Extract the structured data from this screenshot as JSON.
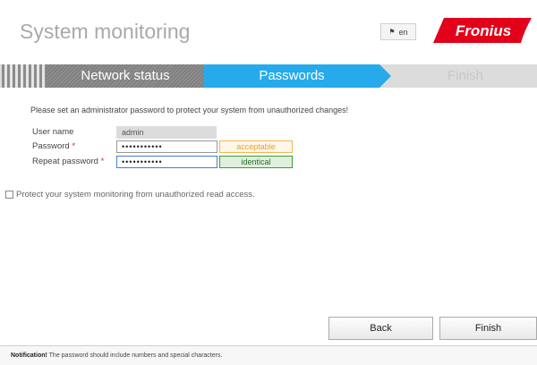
{
  "header": {
    "title": "System monitoring",
    "lang_label": "en",
    "lang_icon": "flag-icon",
    "brand": "Fronius",
    "brand_color": "#e3001b"
  },
  "steps": [
    {
      "label": "Network status",
      "state": "done"
    },
    {
      "label": "Passwords",
      "state": "active"
    },
    {
      "label": "Finish",
      "state": "pending"
    }
  ],
  "accent_color": "#26aaec",
  "intro": "Please set an administrator password to protect your system from unauthorized changes!",
  "form": {
    "username_label": "User name",
    "username_value": "admin",
    "password_label": "Password",
    "password_value": "•••••••••••",
    "repeat_label": "Repeat password",
    "repeat_value": "•••••••••••",
    "required_mark": "*",
    "password_status": "acceptable",
    "repeat_status": "identical"
  },
  "protect_label": "Protect your system monitoring from unauthorized read access.",
  "buttons": {
    "back": "Back",
    "finish": "Finish"
  },
  "notification": {
    "prefix": "Notification!",
    "text": " The password should include numbers and special characters."
  }
}
